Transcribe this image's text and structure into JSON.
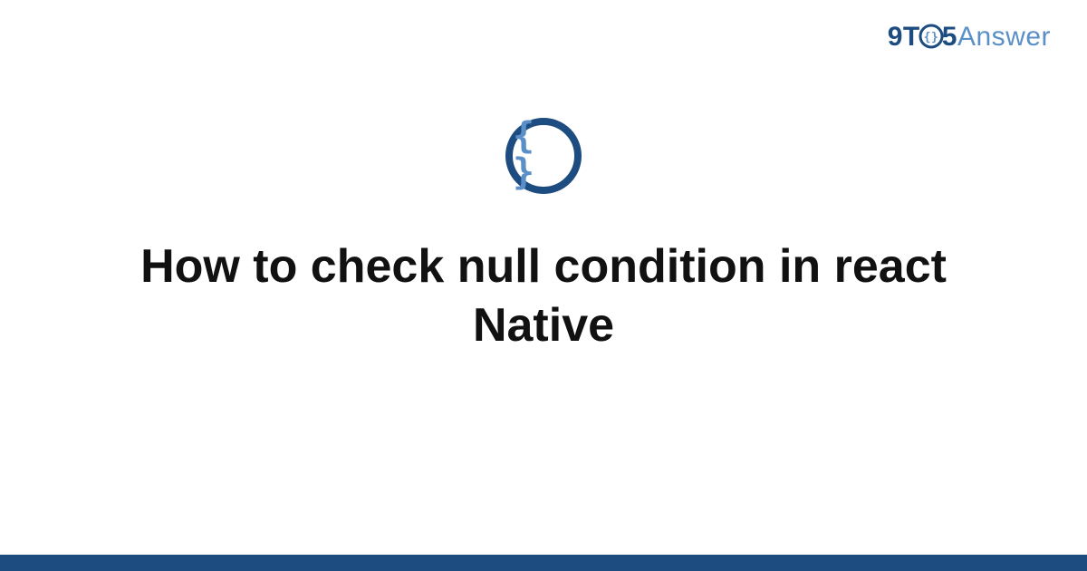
{
  "logo": {
    "prefix": "9T",
    "middle": "5",
    "suffix": "Answer",
    "icon_name": "braces-circle-icon"
  },
  "category_icon": {
    "glyph": "{ }",
    "name": "curly-braces-icon"
  },
  "title": "How to check null condition in react Native",
  "colors": {
    "brand_dark": "#1d4c80",
    "brand_light": "#5a8fc8",
    "text": "#111111",
    "background": "#ffffff"
  }
}
